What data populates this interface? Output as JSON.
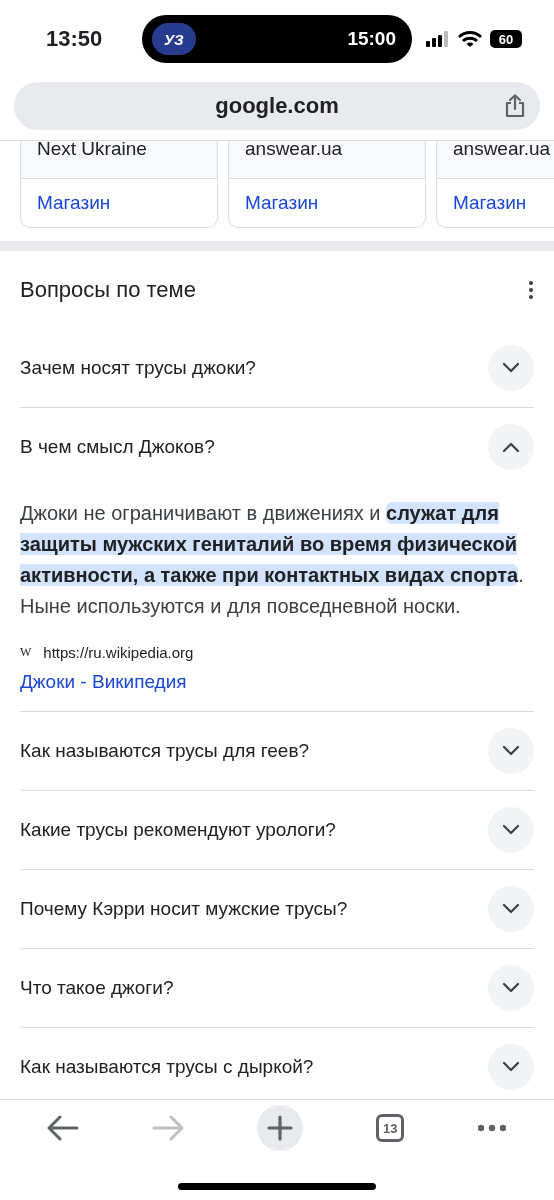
{
  "status_bar": {
    "time": "13:50",
    "island_badge": "УЗ",
    "island_time": "15:00",
    "battery": "60"
  },
  "address_bar": {
    "url": "google.com"
  },
  "cards": [
    {
      "source": "Next Ukraine",
      "action": "Магазин"
    },
    {
      "source": "answear.ua",
      "action": "Магазин"
    },
    {
      "source": "answear.ua",
      "action": "Магазин"
    }
  ],
  "related_questions": {
    "title": "Вопросы по теме",
    "items": [
      {
        "question": "Зачем носят трусы джоки?",
        "expanded": false
      },
      {
        "question": "В чем смысл Джоков?",
        "expanded": true,
        "answer": "Джоки не ограничивают в движениях и **служат для защиты мужских гениталий во время физической активности, а также при контактных видах спорта**. Ныне используются и для повседневной носки.",
        "source_icon": "W",
        "source_url": "https://ru.wikipedia.org",
        "source_title": "Джоки - Википедия"
      },
      {
        "question": "Как называются трусы для геев?",
        "expanded": false
      },
      {
        "question": "Какие трусы рекомендуют урологи?",
        "expanded": false
      },
      {
        "question": "Почему Кэрри носит мужские трусы?",
        "expanded": false
      },
      {
        "question": "Что такое джоги?",
        "expanded": false
      },
      {
        "question": "Как называются трусы с дыркой?",
        "expanded": false
      }
    ]
  },
  "toolbar": {
    "tab_count": "13"
  }
}
